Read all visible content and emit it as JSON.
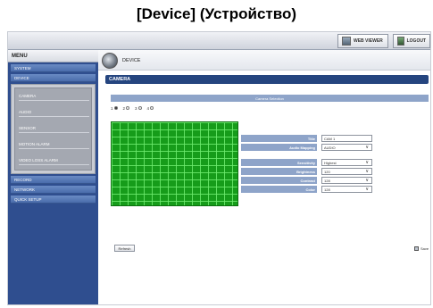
{
  "caption": "[Device] (Устройство)",
  "topbar": {
    "web_viewer": "WEB VIEWER",
    "logout": "LOGOUT"
  },
  "sidebar": {
    "title": "MENU",
    "items": [
      {
        "label": "SYSTEM"
      },
      {
        "label": "DEVICE"
      },
      {
        "label": "RECORD"
      },
      {
        "label": "NETWORK"
      },
      {
        "label": "QUICK SETUP"
      }
    ],
    "sub_items": [
      {
        "label": "CAMERA"
      },
      {
        "label": "AUDIO"
      },
      {
        "label": "SENSOR"
      },
      {
        "label": "MOTION ALARM"
      },
      {
        "label": "VIDEO LOSS ALARM"
      }
    ]
  },
  "header": {
    "breadcrumb": "DEVICE"
  },
  "section": {
    "title": "CAMERA",
    "selection_title": "Camera Selection",
    "cameras": [
      {
        "label": "1",
        "selected": true
      },
      {
        "label": "2",
        "selected": false
      },
      {
        "label": "3",
        "selected": false
      },
      {
        "label": "4",
        "selected": false
      }
    ]
  },
  "properties": [
    {
      "label": "Title",
      "value": "CAM 1",
      "type": "text"
    },
    {
      "label": "Audio Mapping",
      "value": "AUDIO",
      "type": "select"
    },
    {
      "label": "Sensitivity",
      "value": "Highest",
      "type": "select"
    },
    {
      "label": "Brightness",
      "value": "120",
      "type": "select"
    },
    {
      "label": "Contrast",
      "value": "128",
      "type": "select"
    },
    {
      "label": "Color",
      "value": "128",
      "type": "select"
    }
  ],
  "actions": {
    "refresh": "Refresh",
    "save": "Save"
  },
  "colors": {
    "sidebar_bg": "#2f4e8f",
    "section_bar": "#25457f",
    "label_bg": "#8ea4c9",
    "preview_green": "#169c1a"
  }
}
